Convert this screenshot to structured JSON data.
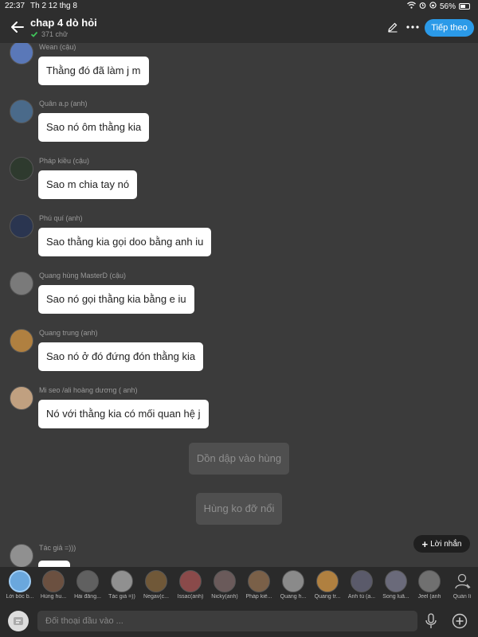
{
  "status": {
    "time": "22:37",
    "date": "Th 2 12 thg 8",
    "battery": "56%"
  },
  "header": {
    "title": "chap 4 dò hỏi",
    "word_count": "371 chữ",
    "next_label": "Tiếp theo"
  },
  "messages": [
    {
      "sender": "Wean (cậu)",
      "text": "Thằng đó đã làm j m",
      "avatar_color": "#5a78b8"
    },
    {
      "sender": "Quân a.p (anh)",
      "text": "Sao nó ôm thằng kia",
      "avatar_color": "#4a6a8a"
    },
    {
      "sender": "Pháp kiều (cậu)",
      "text": "Sao m chia tay nó",
      "avatar_color": "#2e3a2e"
    },
    {
      "sender": "Phú quí (anh)",
      "text": "Sao thằng kia gọi doo bằng anh iu",
      "avatar_color": "#2a3550"
    },
    {
      "sender": "Quang hùng MasterD (cậu)",
      "text": "Sao nó gọi thằng kia bằng e iu",
      "avatar_color": "#7a7a7a"
    },
    {
      "sender": "Quang trung (anh)",
      "text": "Sao nó ở đó đứng đón thằng kia",
      "avatar_color": "#b08040"
    },
    {
      "sender": "Mi seo /ali hoàng dương ( anh)",
      "text": "Nó với thằng kia có mối quan hệ j",
      "avatar_color": "#c0a080"
    }
  ],
  "narration": [
    "Dồn dập vào hùng",
    "Hùng ko đỡ nổi"
  ],
  "last_sender": "Tác giả =)))",
  "reply_label": "Lời nhắn",
  "characters": [
    {
      "name": "Lời bốc b...",
      "color": "#6aa7dd"
    },
    {
      "name": "Hùng hu...",
      "color": "#6b5040"
    },
    {
      "name": "Hải đăng...",
      "color": "#606060"
    },
    {
      "name": "Tác giả =))",
      "color": "#909090"
    },
    {
      "name": "Negav(c...",
      "color": "#705838"
    },
    {
      "name": "Issac(anh)",
      "color": "#8a4a4a"
    },
    {
      "name": "Nicky(anh)",
      "color": "#6a5a5a"
    },
    {
      "name": "Pháp kiề...",
      "color": "#7a6048"
    },
    {
      "name": "Quang h...",
      "color": "#8a8a8a"
    },
    {
      "name": "Quang tr...",
      "color": "#b08040"
    },
    {
      "name": "Anh tú (a...",
      "color": "#5a5a6a"
    },
    {
      "name": "Song luâ...",
      "color": "#6a6a7a"
    },
    {
      "name": "Jeel (anh",
      "color": "#707070"
    }
  ],
  "manage_label": "Quản lí",
  "composer": {
    "placeholder": "Đối thoại đầu vào ..."
  }
}
